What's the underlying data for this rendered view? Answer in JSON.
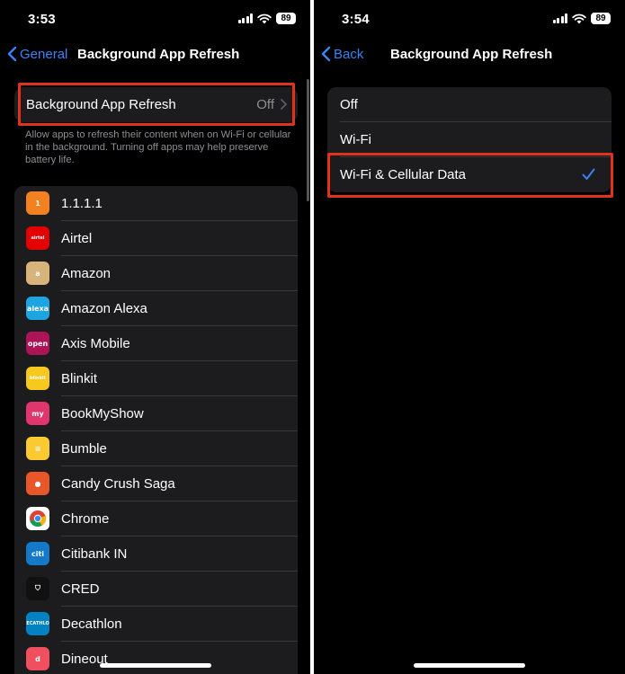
{
  "left": {
    "status": {
      "time": "3:53",
      "battery": "89"
    },
    "nav": {
      "back_label": "General",
      "title": "Background App Refresh"
    },
    "main_row": {
      "label": "Background App Refresh",
      "value": "Off"
    },
    "footer": "Allow apps to refresh their content when on Wi-Fi or cellular in the background. Turning off apps may help preserve battery life.",
    "apps": [
      {
        "name": "1.1.1.1",
        "icon": "cloudflare-1111-icon",
        "color": "#f48120",
        "glyph": "1"
      },
      {
        "name": "Airtel",
        "icon": "airtel-icon",
        "color": "#e40000",
        "glyph": "airtel"
      },
      {
        "name": "Amazon",
        "icon": "amazon-icon",
        "color": "#d8b37a",
        "glyph": "a"
      },
      {
        "name": "Amazon Alexa",
        "icon": "alexa-icon",
        "color": "#1fa4e2",
        "glyph": "alexa"
      },
      {
        "name": "Axis Mobile",
        "icon": "axis-mobile-icon",
        "color": "#ad1457",
        "glyph": "open"
      },
      {
        "name": "Blinkit",
        "icon": "blinkit-icon",
        "color": "#f7c81e",
        "glyph": "blinkit"
      },
      {
        "name": "BookMyShow",
        "icon": "bookmyshow-icon",
        "color": "#e0356d",
        "glyph": "my"
      },
      {
        "name": "Bumble",
        "icon": "bumble-icon",
        "color": "#fbc932",
        "glyph": "≡"
      },
      {
        "name": "Candy Crush Saga",
        "icon": "candy-crush-icon",
        "color": "#e8562a",
        "glyph": "●"
      },
      {
        "name": "Chrome",
        "icon": "chrome-icon",
        "color": "#ffffff",
        "glyph": ""
      },
      {
        "name": "Citibank IN",
        "icon": "citibank-icon",
        "color": "#1479c9",
        "glyph": "citi"
      },
      {
        "name": "CRED",
        "icon": "cred-icon",
        "color": "#111111",
        "glyph": "⛉"
      },
      {
        "name": "Decathlon",
        "icon": "decathlon-icon",
        "color": "#0082c3",
        "glyph": "DECATHLON"
      },
      {
        "name": "Dineout",
        "icon": "dineout-icon",
        "color": "#ef4f5f",
        "glyph": "d"
      }
    ]
  },
  "right": {
    "status": {
      "time": "3:54",
      "battery": "89"
    },
    "nav": {
      "back_label": "Back",
      "title": "Background App Refresh"
    },
    "options": [
      {
        "label": "Off",
        "selected": false
      },
      {
        "label": "Wi-Fi",
        "selected": false
      },
      {
        "label": "Wi-Fi & Cellular Data",
        "selected": true
      }
    ]
  },
  "colors": {
    "accent": "#3b82f6",
    "highlight": "#e0321d",
    "cell": "#1c1c1e",
    "secondary_text": "#8e8e93"
  }
}
